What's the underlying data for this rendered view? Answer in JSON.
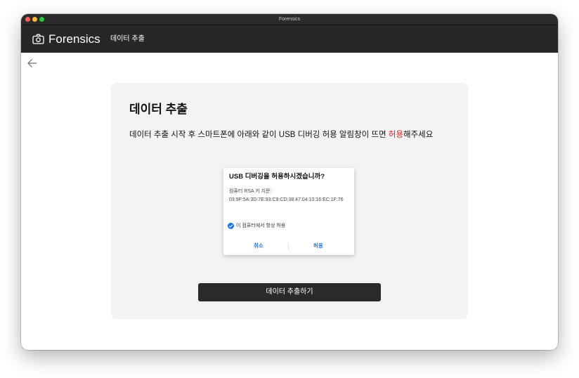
{
  "window": {
    "title": "Forensics"
  },
  "appbar": {
    "brand_icon": "camera-icon",
    "brand": "Forensics",
    "nav_item": "데이터 추출"
  },
  "back_icon": "arrow-left-icon",
  "card": {
    "title": "데이터 추출",
    "description_prefix": "데이터 추출 시작 후 스마트폰에 아래와 같이 USB 디버깅 허용 알림창이 뜨면 ",
    "description_highlight": "허용",
    "description_suffix": "해주세요",
    "highlight_color": "#e02020",
    "extract_button": "데이터 추출하기"
  },
  "dialog": {
    "title": "USB 디버깅을 허용하시겠습니까?",
    "fingerprint_label": "컴퓨터 RSA 키 지문:",
    "fingerprint": "03:9F:5A:3D:7E:93:C9:CD:38:47:04:10:16:EC:1F:76",
    "always_allow_label": "이 컴퓨터에서 항상 허용",
    "always_allow_checked": true,
    "cancel": "취소",
    "allow": "허용",
    "accent_color": "#1a73e8"
  }
}
